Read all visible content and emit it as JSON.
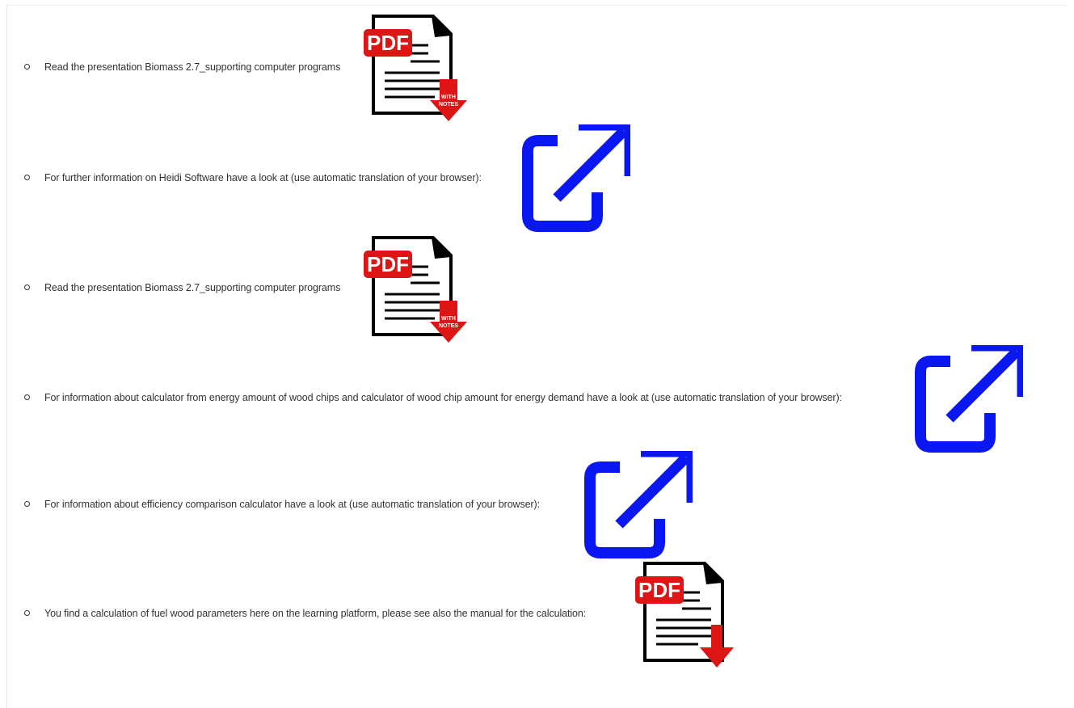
{
  "items": [
    {
      "text": "Read the presentation Biomass 2.7_supporting computer programs",
      "icon": "pdf-with-notes-icon",
      "badge": "PDF",
      "sub1": "WITH",
      "sub2": "NOTES"
    },
    {
      "text": "For further information on Heidi Software have a look at (use automatic translation of your browser):",
      "icon": "external-link-icon"
    },
    {
      "text": "Read the presentation Biomass 2.7_supporting computer programs",
      "icon": "pdf-with-notes-icon",
      "badge": "PDF",
      "sub1": "WITH",
      "sub2": "NOTES"
    },
    {
      "text": "For information about calculator from energy amount of wood chips and calculator of wood chip amount for energy demand have a look at (use automatic translation of your browser):",
      "icon": "external-link-icon"
    },
    {
      "text": "For information about efficiency comparison calculator have a look at (use automatic translation of your browser):",
      "icon": "external-link-icon"
    },
    {
      "text": "You find a calculation of fuel wood parameters here on the learning platform, please see also the manual for the calculation:",
      "icon": "pdf-download-icon",
      "badge": "PDF"
    }
  ],
  "colors": {
    "pdf_red": "#dd1515",
    "link_blue": "#0a17f0",
    "text": "#333333"
  }
}
